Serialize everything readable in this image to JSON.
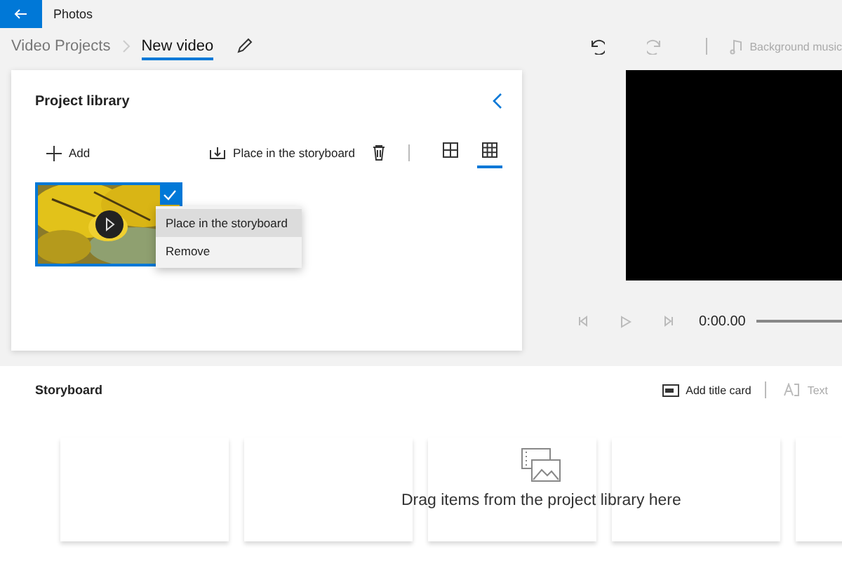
{
  "app": {
    "title": "Photos"
  },
  "breadcrumb": [
    {
      "label": "Video Projects",
      "selected": false
    },
    {
      "label": "New video",
      "selected": true
    }
  ],
  "toolbar": {
    "background_music": {
      "label": "Background music",
      "disabled": true
    }
  },
  "project_library": {
    "title": "Project library",
    "actions": [
      {
        "kind": "add",
        "label": "Add"
      },
      {
        "kind": "place",
        "label": "Place in the storyboard"
      }
    ],
    "views": [
      {
        "selected": false
      },
      {
        "selected": true
      }
    ],
    "items": [
      {
        "kind": "picture",
        "checked": true
      }
    ]
  },
  "context_menu": [
    {
      "label": "Place in the storyboard",
      "selected": true
    },
    {
      "label": "Remove",
      "selected": false
    }
  ],
  "player": {
    "time": "0:00.00"
  },
  "storyboard": {
    "title": "Storyboard",
    "actions": [
      {
        "label": "Add title card",
        "disabled": false
      },
      {
        "label": "Text",
        "disabled": true
      }
    ],
    "slots": [
      {
        "kind": "empty"
      },
      {
        "kind": "empty"
      },
      {
        "kind": "empty"
      },
      {
        "kind": "empty"
      },
      {
        "kind": "empty"
      }
    ],
    "hint": "Drag items from the project library here"
  }
}
